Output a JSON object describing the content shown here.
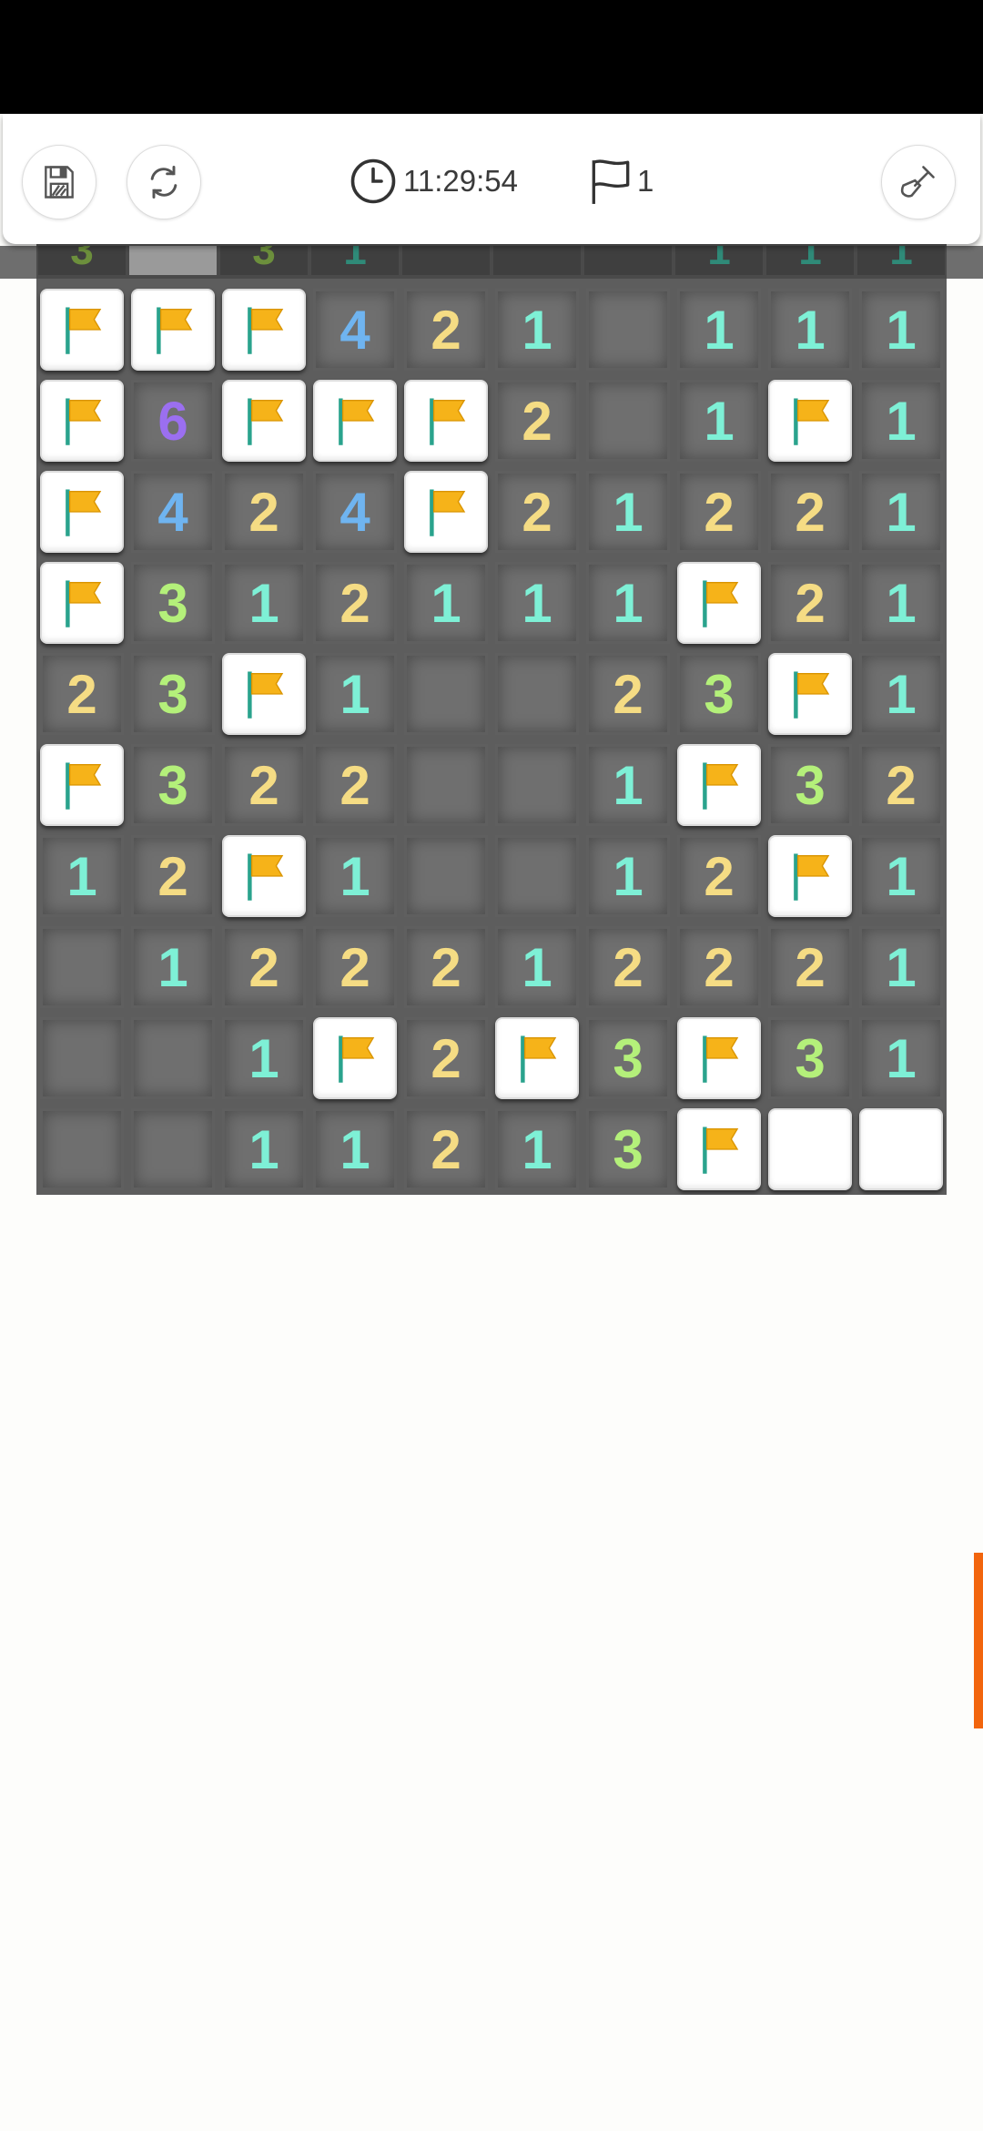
{
  "toolbar": {
    "timer": "11:29:54",
    "flag_count": "1",
    "save_icon": "floppy-disk-icon",
    "restart_icon": "refresh-icon",
    "dig_icon": "shovel-icon"
  },
  "colors": {
    "n1": "#7ef0d6",
    "n2": "#f5dc84",
    "n3": "#b4f07a",
    "n4": "#6fb4f0",
    "n6": "#9b6ff0",
    "flag": "#f6b319",
    "accent": "#f2650d"
  },
  "board": {
    "columns": 10,
    "peek_row": [
      "3",
      "F",
      "3",
      "1",
      "",
      "",
      "",
      "1",
      "1",
      "1"
    ],
    "rows": [
      [
        "F",
        "F",
        "F",
        "4",
        "2",
        "1",
        "",
        "1",
        "1",
        "1"
      ],
      [
        "F",
        "6",
        "F",
        "F",
        "F",
        "2",
        "",
        "1",
        "F",
        "1"
      ],
      [
        "F",
        "4",
        "2",
        "4",
        "F",
        "2",
        "1",
        "2",
        "2",
        "1"
      ],
      [
        "F",
        "3",
        "1",
        "2",
        "1",
        "1",
        "1",
        "F",
        "2",
        "1"
      ],
      [
        "2",
        "3",
        "F",
        "1",
        "",
        "",
        "2",
        "3",
        "F",
        "1"
      ],
      [
        "F",
        "3",
        "2",
        "2",
        "",
        "",
        "1",
        "F",
        "3",
        "2"
      ],
      [
        "1",
        "2",
        "F",
        "1",
        "",
        "",
        "1",
        "2",
        "F",
        "1"
      ],
      [
        "",
        "1",
        "2",
        "2",
        "2",
        "1",
        "2",
        "2",
        "2",
        "1"
      ],
      [
        "",
        "",
        "1",
        "F",
        "2",
        "F",
        "3",
        "F",
        "3",
        "1"
      ],
      [
        "",
        "",
        "1",
        "1",
        "2",
        "1",
        "3",
        "F",
        "H",
        "H"
      ]
    ]
  }
}
